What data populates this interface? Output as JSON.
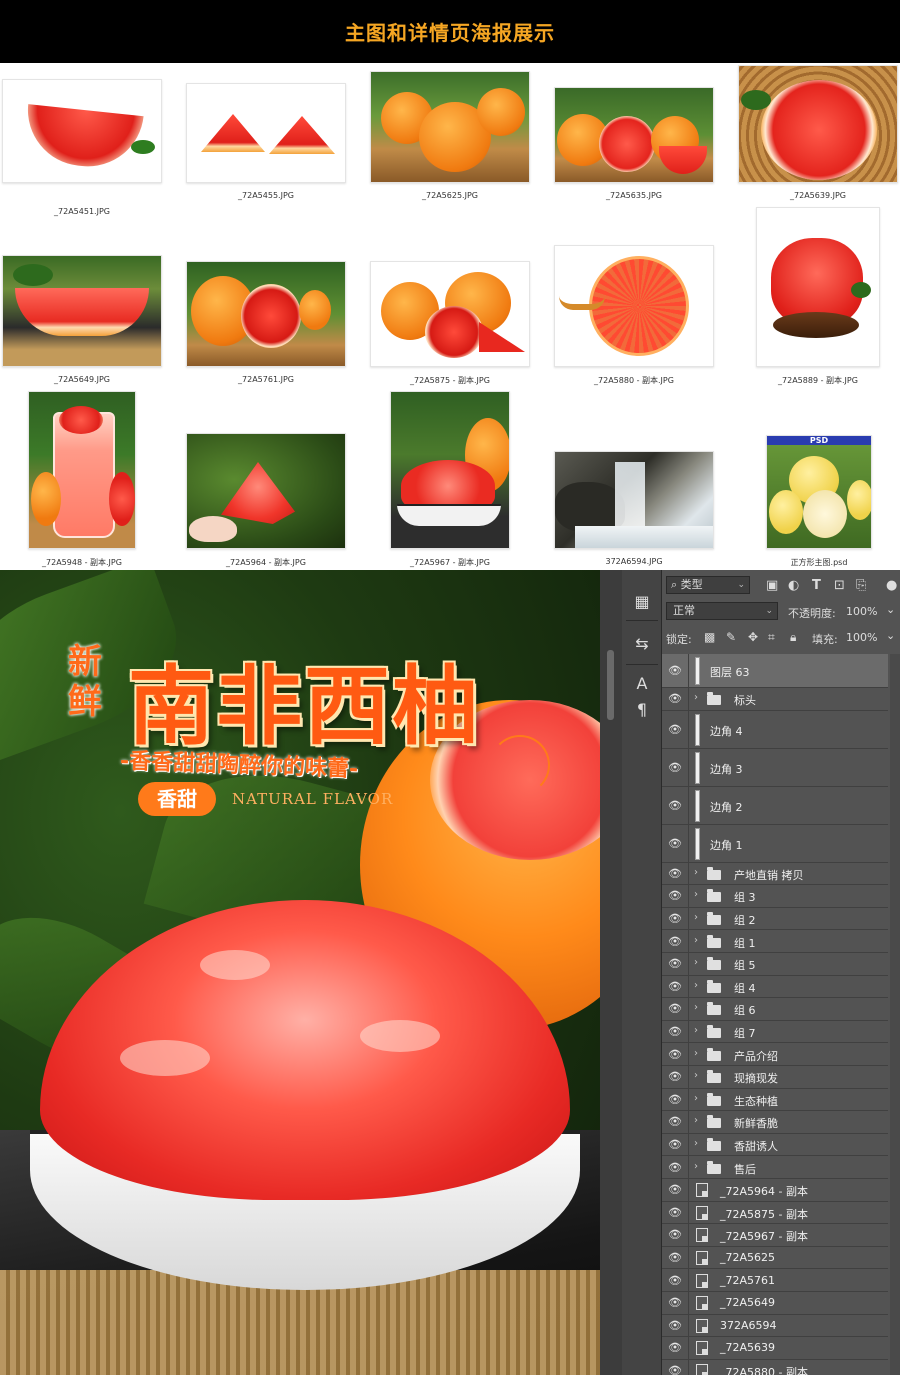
{
  "header": {
    "title": "主图和详情页海报展示"
  },
  "thumbnails": [
    {
      "name": "_72A5451.JPG"
    },
    {
      "name": "_72A5455.JPG"
    },
    {
      "name": "_72A5625.JPG"
    },
    {
      "name": "_72A5635.JPG"
    },
    {
      "name": "_72A5639.JPG"
    },
    {
      "name": "_72A5649.JPG"
    },
    {
      "name": "_72A5761.JPG"
    },
    {
      "name": "_72A5875 - 副本.JPG"
    },
    {
      "name": "_72A5880 - 副本.JPG"
    },
    {
      "name": "_72A5889 - 副本.JPG"
    },
    {
      "name": "_72A5948 - 副本.JPG"
    },
    {
      "name": "_72A5964 - 副本.JPG"
    },
    {
      "name": "_72A5967 - 副本.JPG"
    },
    {
      "name": "372A6594.JPG"
    },
    {
      "name": "正方形主图.psd",
      "badge": "PSD"
    }
  ],
  "poster": {
    "title_small": "新鲜",
    "title_main": "南非西柚",
    "subtitle": "-香香甜甜陶醉你的味蕾-",
    "pill": "香甜",
    "english": "NATURAL FLAVOR"
  },
  "ps_panel": {
    "filter_label": "类型",
    "blend_mode": "正常",
    "opacity_label": "不透明度:",
    "opacity_value": "100%",
    "lock_label": "锁定:",
    "fill_label": "填充:",
    "fill_value": "100%",
    "layers": [
      {
        "name": "图层 63",
        "kind": "pixel",
        "selected": true
      },
      {
        "name": "标头",
        "kind": "group"
      },
      {
        "name": "边角 4",
        "kind": "shape"
      },
      {
        "name": "边角 3",
        "kind": "shape"
      },
      {
        "name": "边角 2",
        "kind": "shape"
      },
      {
        "name": "边角 1",
        "kind": "shape"
      },
      {
        "name": "产地直销 拷贝",
        "kind": "group"
      },
      {
        "name": "组 3",
        "kind": "group"
      },
      {
        "name": "组 2",
        "kind": "group"
      },
      {
        "name": "组 1",
        "kind": "group"
      },
      {
        "name": "组 5",
        "kind": "group"
      },
      {
        "name": "组 4",
        "kind": "group"
      },
      {
        "name": "组 6",
        "kind": "group"
      },
      {
        "name": "组 7",
        "kind": "group"
      },
      {
        "name": "产品介绍",
        "kind": "group"
      },
      {
        "name": "现摘现发",
        "kind": "group"
      },
      {
        "name": "生态种植",
        "kind": "group"
      },
      {
        "name": "新鲜香脆",
        "kind": "group"
      },
      {
        "name": "香甜诱人",
        "kind": "group"
      },
      {
        "name": "售后",
        "kind": "group"
      },
      {
        "name": "_72A5964 - 副本",
        "kind": "smart"
      },
      {
        "name": "_72A5875 - 副本",
        "kind": "smart"
      },
      {
        "name": "_72A5967 - 副本",
        "kind": "smart"
      },
      {
        "name": "_72A5625",
        "kind": "smart"
      },
      {
        "name": "_72A5761",
        "kind": "smart"
      },
      {
        "name": "_72A5649",
        "kind": "smart"
      },
      {
        "name": "372A6594",
        "kind": "smart"
      },
      {
        "name": "_72A5639",
        "kind": "smart"
      },
      {
        "name": "_72A5880 - 副本",
        "kind": "smart"
      }
    ]
  }
}
